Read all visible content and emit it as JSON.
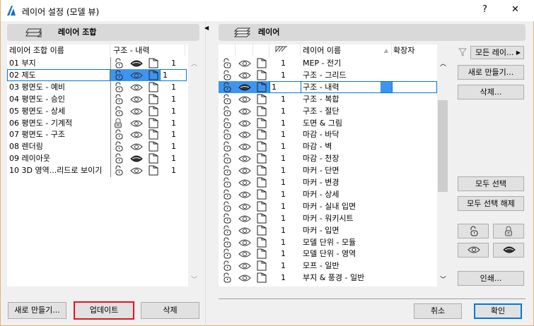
{
  "window": {
    "title": "레이어 설정 (모델 뷰)",
    "help": "?",
    "close": "✕"
  },
  "left": {
    "header": "레이어 조합",
    "col_name": "레이어 조합 이름",
    "col_state": "구조 - 내력",
    "rows": [
      {
        "name": "01 부지",
        "lock": "open",
        "eye": "hidden",
        "num": "1"
      },
      {
        "name": "02 제도",
        "lock": "open",
        "eye": "shown",
        "num": "1",
        "selected": true
      },
      {
        "name": "03 평면도 - 예비",
        "lock": "open",
        "eye": "shown",
        "num": "1"
      },
      {
        "name": "04 평면도 - 승인",
        "lock": "open",
        "eye": "shown",
        "num": "1"
      },
      {
        "name": "05 평면도 - 상세",
        "lock": "open",
        "eye": "shown",
        "num": "1"
      },
      {
        "name": "06 평면도 - 기계적",
        "lock": "locked",
        "eye": "shown",
        "num": "1"
      },
      {
        "name": "07 평면도 - 구조",
        "lock": "open",
        "eye": "shown",
        "num": "1"
      },
      {
        "name": "08 렌더링",
        "lock": "open",
        "eye": "shown",
        "num": "1"
      },
      {
        "name": "09 레이아웃",
        "lock": "open",
        "eye": "hidden",
        "num": "1"
      },
      {
        "name": "10 3D 영역...리드로 보이기",
        "lock": "open",
        "eye": "shown",
        "num": "1"
      }
    ],
    "btn_new": "새로 만들기...",
    "btn_update": "업데이트",
    "btn_delete": "삭제"
  },
  "right": {
    "header": "레이어",
    "col_name": "레이어 이름",
    "col_ext": "확장자",
    "rows": [
      {
        "name": "MEP - 전기",
        "eye": "shown",
        "num": "1"
      },
      {
        "name": "구조 - 그리드",
        "eye": "shown",
        "num": "1"
      },
      {
        "name": "구조 - 내력",
        "eye": "hidden",
        "num": "1",
        "selected": true
      },
      {
        "name": "구조 - 복합",
        "eye": "shown",
        "num": "1"
      },
      {
        "name": "구조 - 절단",
        "eye": "shown",
        "num": "1"
      },
      {
        "name": "도면 & 그림",
        "eye": "shown",
        "num": "1"
      },
      {
        "name": "마감 - 바닥",
        "eye": "shown",
        "num": "1"
      },
      {
        "name": "마감 - 벽",
        "eye": "shown",
        "num": "1"
      },
      {
        "name": "마감 - 천장",
        "eye": "shown",
        "num": "1"
      },
      {
        "name": "마커 - 단면",
        "eye": "shown",
        "num": "1"
      },
      {
        "name": "마커 - 변경",
        "eye": "shown",
        "num": "1"
      },
      {
        "name": "마커 - 상세",
        "eye": "shown",
        "num": "1"
      },
      {
        "name": "마커 - 실내 입면",
        "eye": "shown",
        "num": "1"
      },
      {
        "name": "마커 - 워키시트",
        "eye": "shown",
        "num": "1"
      },
      {
        "name": "마커 - 입면",
        "eye": "shown",
        "num": "1"
      },
      {
        "name": "모델 단위 - 모듈",
        "eye": "shown",
        "num": "1"
      },
      {
        "name": "모델 단위 - 영역",
        "eye": "shown",
        "num": "1"
      },
      {
        "name": "모프 - 일반",
        "eye": "shown",
        "num": "1"
      },
      {
        "name": "부지 & 풍경 - 일반",
        "eye": "shown",
        "num": "1"
      }
    ],
    "filter": "모든 레이...",
    "btn_new": "새로 만들기...",
    "btn_delete": "삭제...",
    "btn_select_all": "모두 선택",
    "btn_deselect_all": "모두 선택 해제",
    "btn_print": "인쇄..."
  },
  "footer": {
    "cancel": "취소",
    "ok": "확인"
  },
  "colors": {
    "selection": "#3d95f0",
    "focus": "#0078d7",
    "highlight_button": "#e81123"
  }
}
